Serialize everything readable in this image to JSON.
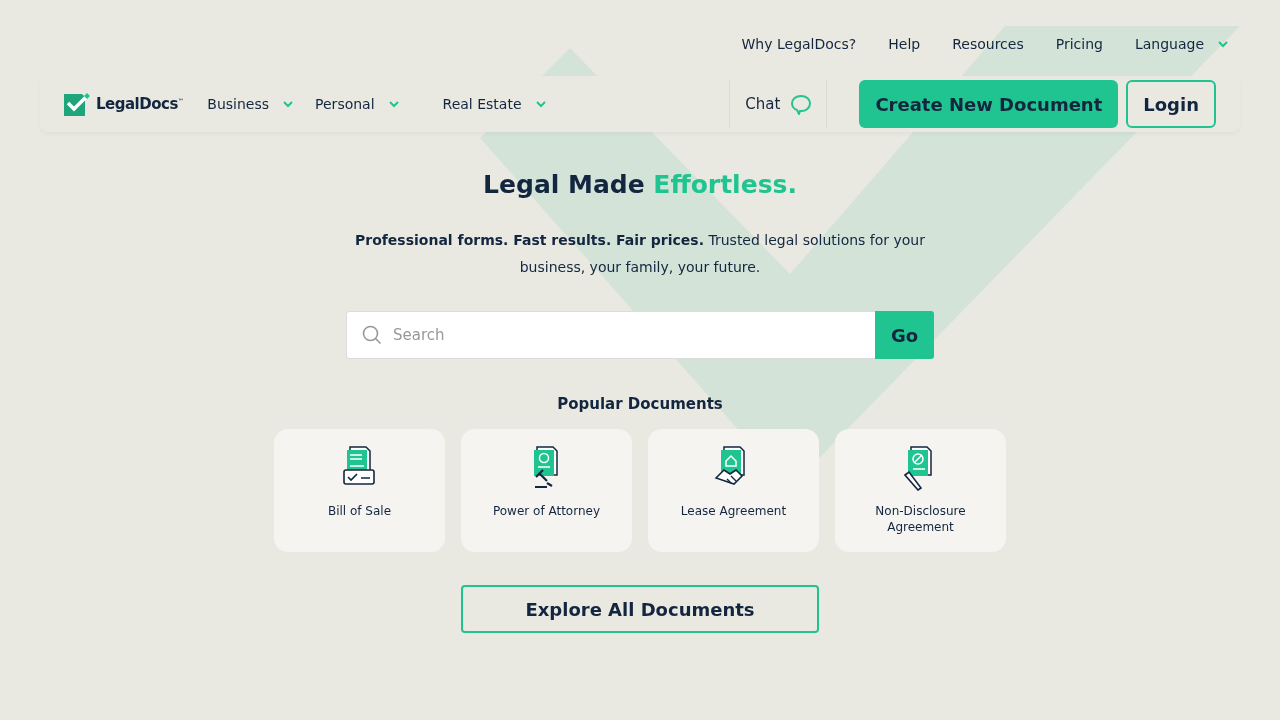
{
  "top_links": [
    "Why LegalDocs?",
    "Help",
    "Resources",
    "Pricing",
    "Language"
  ],
  "logo": {
    "name": "LegalDocs",
    "mark": "™"
  },
  "nav": [
    {
      "label": "Business",
      "kind": "dropdown"
    },
    {
      "label": "Personal",
      "kind": "dropdown"
    },
    {
      "label": "Real Estate",
      "kind": "dropdown"
    }
  ],
  "chat": "Chat",
  "buttons": {
    "primary": "Create New Document",
    "login": "Login"
  },
  "hero": {
    "title": "Legal Made ",
    "accent": "Effortless.",
    "subtitle": "**Professional forms. Fast results. Fair prices.** Trusted legal solutions for your business, your family, your future."
  },
  "search": {
    "placeholder": "Search",
    "button": "Go"
  },
  "popular": {
    "heading": "Popular Documents",
    "items": [
      {
        "label": "Bill of Sale",
        "kind": "sale"
      },
      {
        "label": "Power of Attorney",
        "kind": "gavel"
      },
      {
        "label": "Lease Agreement",
        "kind": "handshake"
      },
      {
        "label": "Non-Disclosure Agreement",
        "kind": "pen"
      }
    ]
  },
  "explore": "Explore All Documents"
}
